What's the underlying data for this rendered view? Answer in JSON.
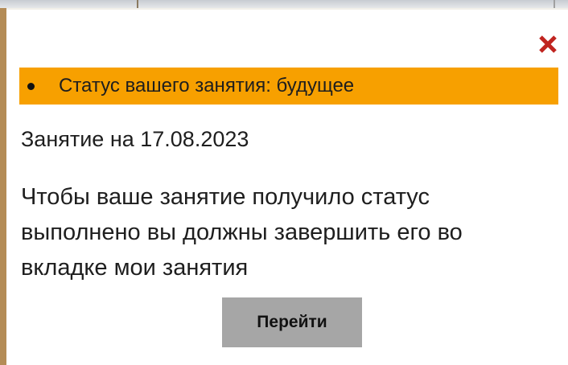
{
  "modal": {
    "close_icon": "close-x-icon",
    "status": {
      "text": "Статус вашего занятия: будущее",
      "color": "#f7a000"
    },
    "date_line": "Занятие на 17.08.2023",
    "info_text": "Чтобы ваше занятие получило статус выполнено вы должны завершить его во вкладке мои занятия",
    "go_button_label": "Перейти",
    "close_icon_color": "#c0241f"
  }
}
